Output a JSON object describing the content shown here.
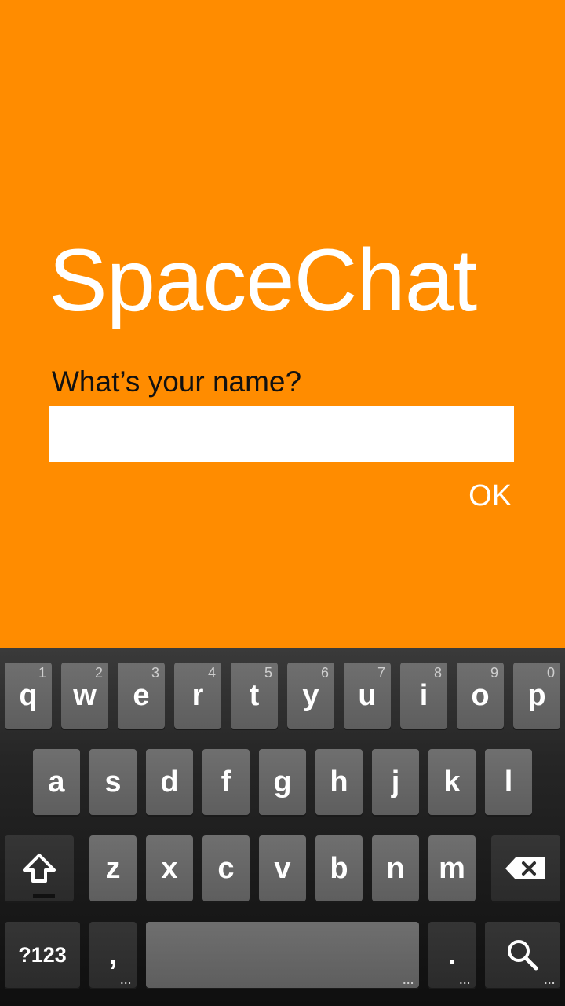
{
  "app": {
    "title": "SpaceChat",
    "prompt": "What’s your name?",
    "name_value": "",
    "ok_label": "OK",
    "colors": {
      "background": "#ff8c00",
      "title": "#ffffff",
      "prompt": "#111111"
    }
  },
  "keyboard": {
    "row1": [
      {
        "label": "q",
        "hint": "1"
      },
      {
        "label": "w",
        "hint": "2"
      },
      {
        "label": "e",
        "hint": "3"
      },
      {
        "label": "r",
        "hint": "4"
      },
      {
        "label": "t",
        "hint": "5"
      },
      {
        "label": "y",
        "hint": "6"
      },
      {
        "label": "u",
        "hint": "7"
      },
      {
        "label": "i",
        "hint": "8"
      },
      {
        "label": "o",
        "hint": "9"
      },
      {
        "label": "p",
        "hint": "0"
      }
    ],
    "row2": [
      "a",
      "s",
      "d",
      "f",
      "g",
      "h",
      "j",
      "k",
      "l"
    ],
    "row3": [
      "z",
      "x",
      "c",
      "v",
      "b",
      "n",
      "m"
    ],
    "symbols_label": "?123",
    "comma_label": ",",
    "period_label": ".",
    "more_dots": "...",
    "icons": {
      "shift": "shift-icon",
      "backspace": "backspace-icon",
      "search": "search-icon"
    }
  }
}
